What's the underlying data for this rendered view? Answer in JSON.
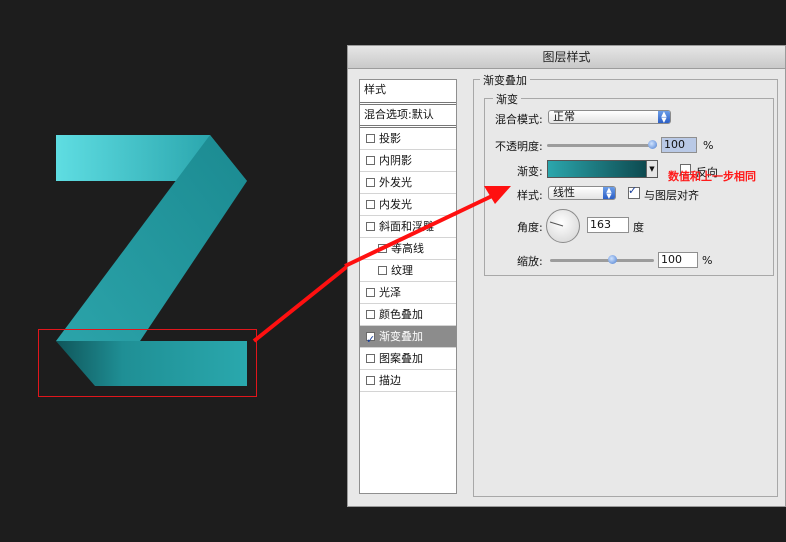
{
  "dialog": {
    "title": "图层样式"
  },
  "sidebar": {
    "header": "样式",
    "blend_options": "混合选项:默认",
    "items": [
      {
        "label": "投影",
        "checked": false,
        "sub": false,
        "active": false
      },
      {
        "label": "内阴影",
        "checked": false,
        "sub": false,
        "active": false
      },
      {
        "label": "外发光",
        "checked": false,
        "sub": false,
        "active": false
      },
      {
        "label": "内发光",
        "checked": false,
        "sub": false,
        "active": false
      },
      {
        "label": "斜面和浮雕",
        "checked": false,
        "sub": false,
        "active": false
      },
      {
        "label": "等高线",
        "checked": false,
        "sub": true,
        "active": false
      },
      {
        "label": "纹理",
        "checked": false,
        "sub": true,
        "active": false
      },
      {
        "label": "光泽",
        "checked": false,
        "sub": false,
        "active": false
      },
      {
        "label": "颜色叠加",
        "checked": false,
        "sub": false,
        "active": false
      },
      {
        "label": "渐变叠加",
        "checked": true,
        "sub": false,
        "active": true
      },
      {
        "label": "图案叠加",
        "checked": false,
        "sub": false,
        "active": false
      },
      {
        "label": "描边",
        "checked": false,
        "sub": false,
        "active": false
      }
    ]
  },
  "panel": {
    "group_title": "渐变叠加",
    "sub_group_title": "渐变",
    "blend_mode_label": "混合模式:",
    "blend_mode_value": "正常",
    "opacity_label": "不透明度:",
    "opacity_value": "100",
    "opacity_unit": "%",
    "gradient_label": "渐变:",
    "reverse_label": "反向",
    "reverse_checked": false,
    "style_label": "样式:",
    "style_value": "线性",
    "align_label": "与图层对齐",
    "align_checked": true,
    "angle_label": "角度:",
    "angle_value": "163",
    "angle_unit": "度",
    "scale_label": "缩放:",
    "scale_value": "100",
    "scale_unit": "%",
    "opacity_level_pct": 100,
    "scale_level_pct": 60
  },
  "annotation": {
    "text": "数值和上一步相同",
    "color": "#ff1a1a"
  },
  "colors": {
    "z_light": "#5fd6dc",
    "z_mid": "#2ba6ac",
    "z_dark": "#16767b",
    "highlight_box": "#e0161c"
  }
}
